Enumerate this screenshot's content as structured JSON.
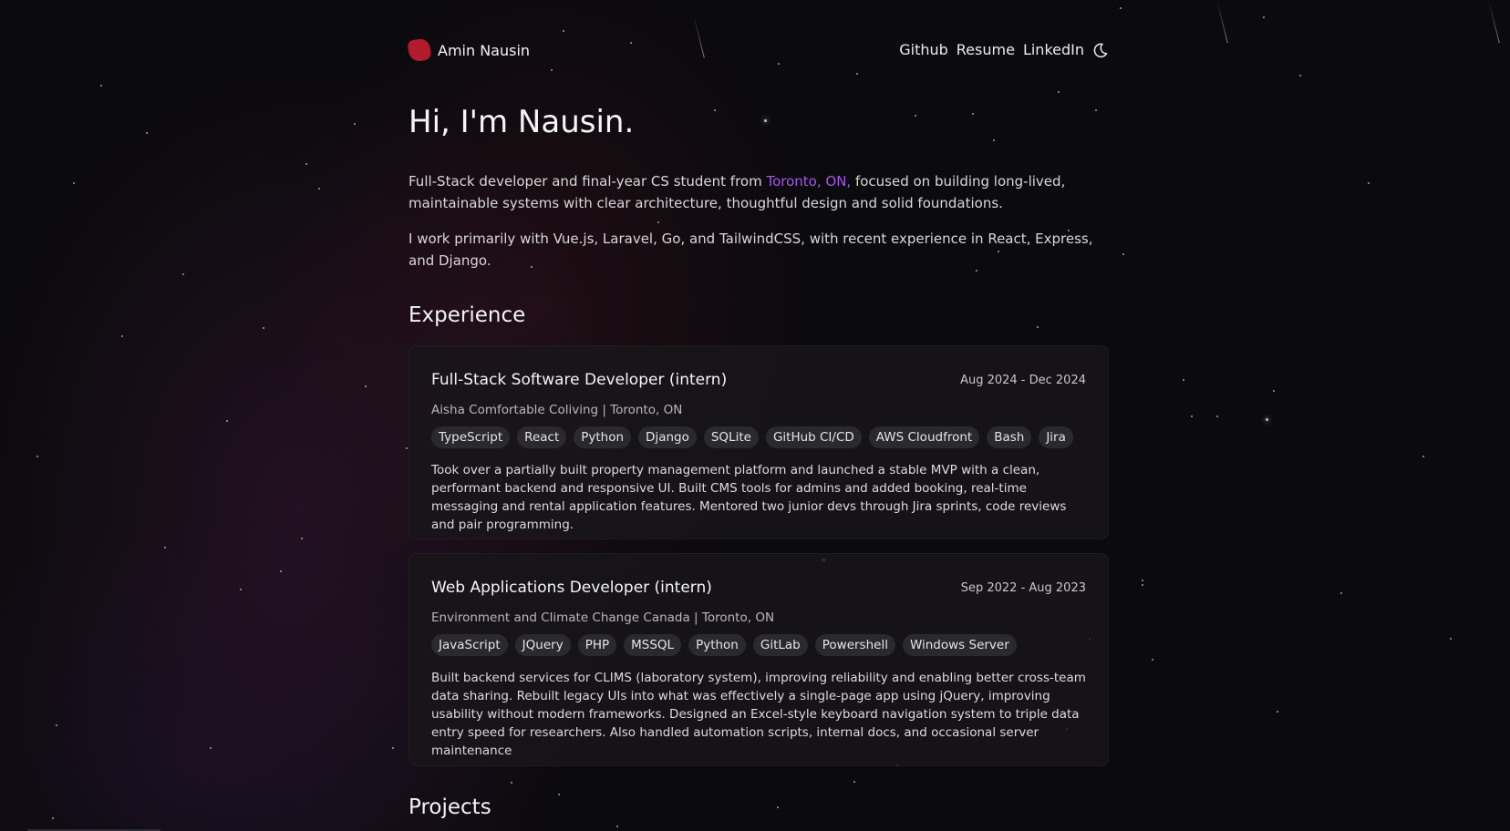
{
  "brand": {
    "name": "Amin Nausin",
    "logo_color": "#b01b2e"
  },
  "nav": {
    "links": [
      "Github",
      "Resume",
      "LinkedIn"
    ],
    "theme_icon": "moon-icon"
  },
  "hero": {
    "title": "Hi, I'm Nausin.",
    "intro_before": "Full-Stack developer and final-year CS student from ",
    "intro_location": "Toronto, ON,",
    "intro_after": " focused on building long-lived, maintainable systems with clear architecture, thoughtful design and solid foundations.",
    "stack": "I work primarily with Vue.js, Laravel, Go, and TailwindCSS, with recent experience in React, Express, and Django."
  },
  "colors": {
    "accent": "#a557e8",
    "background": "#0b0a0d"
  },
  "experience": {
    "heading": "Experience",
    "items": [
      {
        "role": "Full-Stack Software Developer (intern)",
        "dates": "Aug 2024 - Dec 2024",
        "company": "Aisha Comfortable Coliving | Toronto, ON",
        "tags": [
          "TypeScript",
          "React",
          "Python",
          "Django",
          "SQLite",
          "GitHub CI/CD",
          "AWS Cloudfront",
          "Bash",
          "Jira"
        ],
        "description": "Took over a partially built property management platform and launched a stable MVP with a clean, performant backend and responsive UI. Built CMS tools for admins and added booking, real-time messaging and rental application features. Mentored two junior devs through Jira sprints, code reviews and pair programming."
      },
      {
        "role": "Web Applications Developer (intern)",
        "dates": "Sep 2022 - Aug 2023",
        "company": "Environment and Climate Change Canada | Toronto, ON",
        "tags": [
          "JavaScript",
          "JQuery",
          "PHP",
          "MSSQL",
          "Python",
          "GitLab",
          "Powershell",
          "Windows Server"
        ],
        "description": "Built backend services for CLIMS (laboratory system), improving reliability and enabling better cross-team data sharing. Rebuilt legacy UIs into what was effectively a single-page app using jQuery, improving usability without modern frameworks. Designed an Excel-style keyboard navigation system to triple data entry speed for researchers. Also handled automation scripts, internal docs, and occasional server maintenance"
      }
    ]
  },
  "projects": {
    "heading": "Projects"
  }
}
